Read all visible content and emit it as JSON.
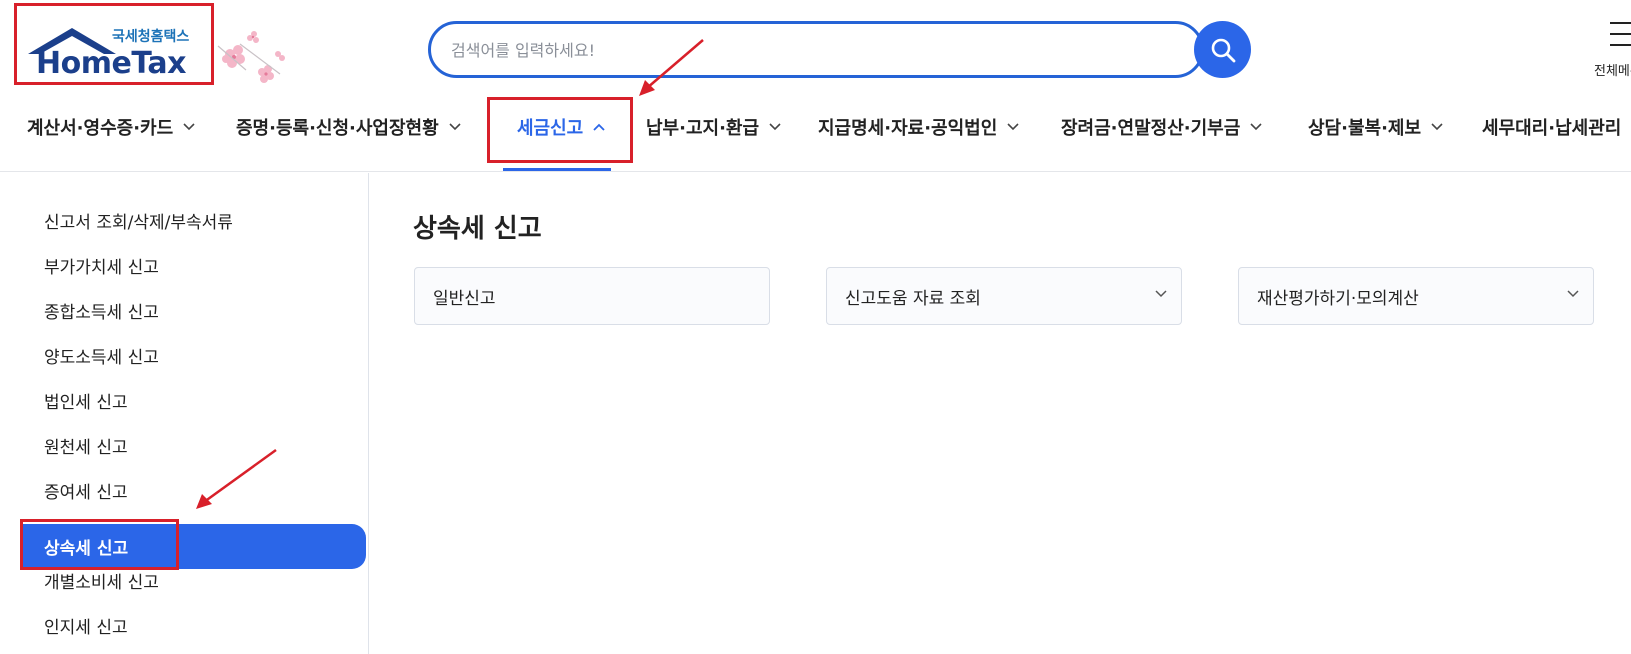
{
  "header": {
    "logo_sub": "국세청홈택스",
    "logo_main": "HomeTax",
    "search_placeholder": "검색어를 입력하세요!",
    "all_menu_label": "전체메뉴"
  },
  "gnb": {
    "items": [
      {
        "label": "계산서·영수증·카드"
      },
      {
        "label": "증명·등록·신청·사업장현황"
      },
      {
        "label": "세금신고"
      },
      {
        "label": "납부·고지·환급"
      },
      {
        "label": "지급명세·자료·공익법인"
      },
      {
        "label": "장려금·연말정산·기부금"
      },
      {
        "label": "상담·불복·제보"
      },
      {
        "label": "세무대리·납세관리"
      }
    ]
  },
  "sidebar": {
    "items": [
      {
        "label": "신고서 조회/삭제/부속서류"
      },
      {
        "label": "부가가치세 신고"
      },
      {
        "label": "종합소득세 신고"
      },
      {
        "label": "양도소득세 신고"
      },
      {
        "label": "법인세 신고"
      },
      {
        "label": "원천세 신고"
      },
      {
        "label": "증여세 신고"
      },
      {
        "label": "상속세 신고"
      },
      {
        "label": "개별소비세 신고"
      },
      {
        "label": "인지세 신고"
      }
    ]
  },
  "main": {
    "title": "상속세 신고",
    "cards": [
      {
        "label": "일반신고"
      },
      {
        "label": "신고도움 자료 조회"
      },
      {
        "label": "재산평가하기·모의계산"
      }
    ]
  },
  "colors": {
    "accent": "#2b66e8",
    "highlight": "#d8202a"
  }
}
